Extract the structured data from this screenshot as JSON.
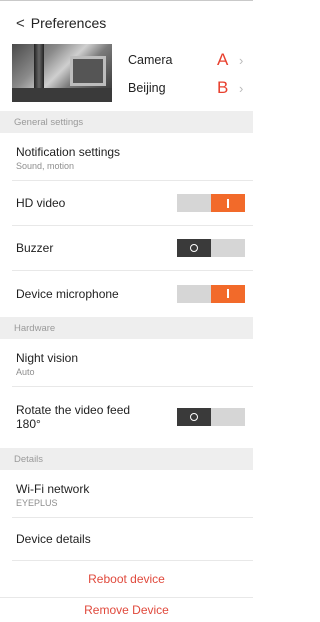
{
  "header": {
    "back_glyph": "<",
    "title": "Preferences"
  },
  "camera_card": {
    "rows": [
      {
        "label": "Camera",
        "letter": "A"
      },
      {
        "label": "Beijing",
        "letter": "B"
      }
    ],
    "chevron_glyph": "›"
  },
  "sections": {
    "general": "General settings",
    "hardware": "Hardware",
    "details": "Details"
  },
  "general": {
    "notification": {
      "label": "Notification settings",
      "sub": "Sound, motion"
    },
    "hd_video": {
      "label": "HD video",
      "on": true
    },
    "buzzer": {
      "label": "Buzzer",
      "on": false
    },
    "microphone": {
      "label": "Device microphone",
      "on": true
    }
  },
  "hardware": {
    "night_vision": {
      "label": "Night vision",
      "sub": "Auto"
    },
    "rotate": {
      "label_line1": "Rotate the video feed",
      "label_line2": "180°",
      "on": false
    }
  },
  "details": {
    "wifi": {
      "label": "Wi-Fi network",
      "sub": "EYEPLUS"
    },
    "device_details": {
      "label": "Device details"
    }
  },
  "actions": {
    "reboot": "Reboot device",
    "remove": "Remove Device"
  },
  "colors": {
    "accent": "#f26a2a",
    "danger_text": "#e0493c",
    "letter": "#e8402e",
    "section_bg": "#eeeeee"
  }
}
